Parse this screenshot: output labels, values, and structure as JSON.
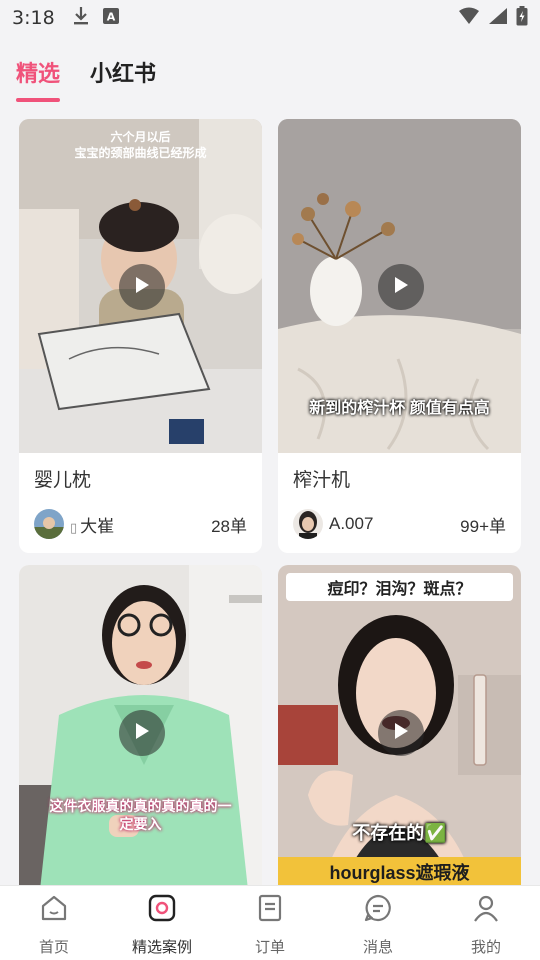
{
  "status_bar": {
    "time": "3:18",
    "left_icons": [
      "download-icon",
      "a-badge-icon"
    ],
    "right_icons": [
      "wifi-icon",
      "signal-icon",
      "battery-icon"
    ]
  },
  "tabs": [
    {
      "label": "精选",
      "active": true
    },
    {
      "label": "小红书",
      "active": false
    }
  ],
  "accent_color": "#f0527a",
  "cards": [
    {
      "title": "婴儿枕",
      "author": "大崔",
      "author_prefix": "",
      "orders": "28单",
      "overlay_text": "六个月以后\n宝宝的颈部曲线已经形成"
    },
    {
      "title": "榨汁机",
      "author": "A.007",
      "orders": "99+单",
      "overlay_text": "新到的榨汁杯 颜值有点高"
    },
    {
      "overlay_text": "这件衣服真的真的真的真的一\n定要入"
    },
    {
      "overlay_top": "痘印？泪沟？斑点？",
      "overlay_mid": "不存在的✅",
      "overlay_bottom": "hourglass遮瑕液"
    }
  ],
  "bottom_nav": [
    {
      "label": "首页",
      "icon": "home-icon"
    },
    {
      "label": "精选案例",
      "icon": "featured-icon",
      "active": true
    },
    {
      "label": "订单",
      "icon": "orders-icon"
    },
    {
      "label": "消息",
      "icon": "message-icon"
    },
    {
      "label": "我的",
      "icon": "profile-icon"
    }
  ]
}
